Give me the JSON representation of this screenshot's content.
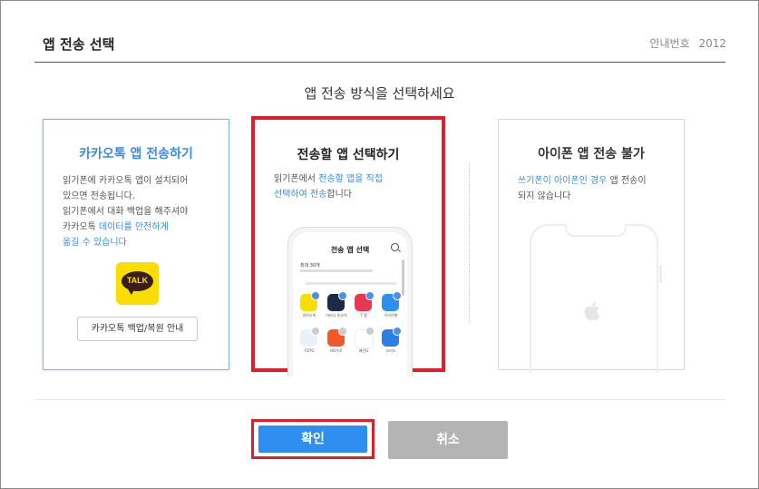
{
  "dialog": {
    "title": "앱 전송 선택",
    "notice_label": "안내번호",
    "notice_number": "2012",
    "subtitle": "앱 전송 방식을 선택하세요"
  },
  "cards": {
    "kakao": {
      "title": "카카오톡 앱 전송하기",
      "desc_line1": "읽기폰에 카카오톡 앱이 설치되어",
      "desc_line2": "있으면 전송됩니다.",
      "desc_line3": "읽기폰에서 대화 백업을 해주셔야",
      "desc_line4a": "카카오톡 ",
      "desc_line4b": "데이터를 안전하게",
      "desc_line5": "옮길 수 있습니다",
      "logo_text": "TALK",
      "button_label": "카카오톡 백업/복원 안내"
    },
    "select": {
      "title": "전송할 앱 선택하기",
      "desc_a": "읽기폰에서 ",
      "desc_b": "전송할 앱을 직접",
      "desc_c": "선택하여 전송",
      "desc_d": "합니다",
      "phone_title": "전송 앱 선택",
      "phone_subtitle": "최대 30개",
      "apps": [
        {
          "label": "카카오톡",
          "color": "#f9de00",
          "checked": true
        },
        {
          "label": "티머니\n온코치",
          "color": "#1b2a49",
          "checked": true
        },
        {
          "label": "T 맵",
          "color": "#e8384f",
          "checked": true
        },
        {
          "label": "우리은행",
          "color": "#2f8ff0",
          "checked": true
        },
        {
          "label": "FOTO",
          "color": "#e9f2fb",
          "checked": false
        },
        {
          "label": "HD우로",
          "color": "#f05a28",
          "checked": false
        },
        {
          "label": "배민G",
          "color": "#ffffff",
          "checked": false
        },
        {
          "label": "오비오",
          "color": "#2b7fe0",
          "checked": true
        }
      ]
    },
    "iphone": {
      "title": "아이폰 앱 전송 불가",
      "desc_a": "쓰기폰이 아이폰인 경우",
      "desc_b": " 앱 전송이",
      "desc_c": "되지 않습니다"
    }
  },
  "buttons": {
    "confirm": "확인",
    "cancel": "취소"
  },
  "colors": {
    "accent": "#2f8ff0",
    "highlight": "#e21d2b",
    "cancel": "#b4b4b4"
  }
}
